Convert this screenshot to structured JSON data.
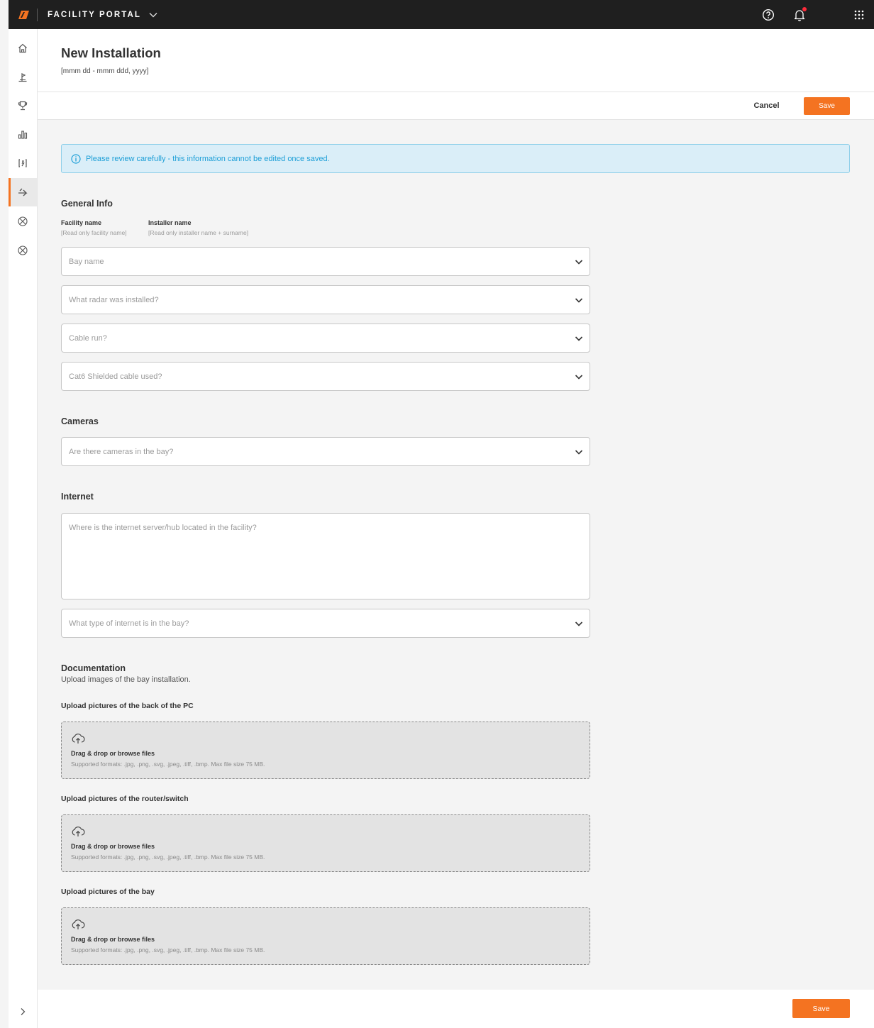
{
  "app": {
    "brand": "FACILITY PORTAL"
  },
  "page": {
    "title": "New Installation",
    "date_range": "[mmm dd - mmm ddd, yyyy]"
  },
  "actions": {
    "cancel_label": "Cancel",
    "save_label": "Save"
  },
  "alert": {
    "text": "Please review carefully - this information cannot be edited once saved."
  },
  "general_info": {
    "title": "General Info",
    "facility_label": "Facility name",
    "facility_value": "[Read only facility name]",
    "installer_label": "Installer name",
    "installer_value": "[Read only installer name + surname]",
    "bay_placeholder": "Bay name",
    "radar_placeholder": "What radar was installed?",
    "cable_placeholder": "Cable run?",
    "cat6_placeholder": "Cat6 Shielded cable used?"
  },
  "cameras": {
    "title": "Cameras",
    "placeholder": "Are there cameras in the bay?"
  },
  "internet": {
    "title": "Internet",
    "location_placeholder": "Where is the internet server/hub located in the facility?",
    "type_placeholder": "What type of internet is in the bay?"
  },
  "documentation": {
    "title": "Documentation",
    "subtitle": "Upload images of the bay installation.",
    "uploads": [
      {
        "label": "Upload pictures of the back of the PC",
        "title": "Drag & drop or browse files",
        "formats": "Supported formats: .jpg, .png, .svg, .jpeg, .tiff, .bmp. Max file size 75 MB."
      },
      {
        "label": "Upload pictures of the router/switch",
        "title": "Drag & drop or browse files",
        "formats": "Supported formats: .jpg, .png, .svg, .jpeg, .tiff, .bmp. Max file size 75 MB."
      },
      {
        "label": "Upload pictures of the bay",
        "title": "Drag & drop or browse files",
        "formats": "Supported formats: .jpg, .png, .svg, .jpeg, .tiff, .bmp. Max file size 75 MB."
      }
    ]
  },
  "footer": {
    "save_label": "Save"
  },
  "colors": {
    "accent": "#f47321",
    "topbar": "#1f1f1f",
    "alert_bg": "#daeef8",
    "alert_text": "#1e9fd7",
    "notification": "#ff2b3a"
  }
}
